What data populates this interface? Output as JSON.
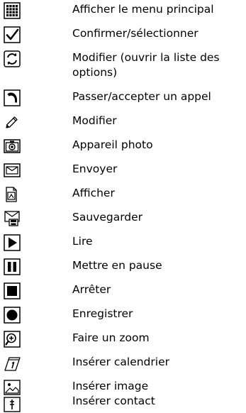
{
  "items": [
    {
      "icon": "main-menu-grid-icon",
      "label": "Afficher le menu principal"
    },
    {
      "icon": "checkmark-icon",
      "label": "Confirmer/sélectionner"
    },
    {
      "icon": "options-cycle-icon",
      "label": "Modifier (ouvrir la liste des options)"
    },
    {
      "icon": "phone-handset-icon",
      "label": "Passer/accepter un appel"
    },
    {
      "icon": "pencil-icon",
      "label": "Modifier"
    },
    {
      "icon": "camera-icon",
      "label": "Appareil photo"
    },
    {
      "icon": "envelope-icon",
      "label": "Envoyer"
    },
    {
      "icon": "display-icon",
      "label": "Afficher"
    },
    {
      "icon": "save-icon",
      "label": "Sauvegarder"
    },
    {
      "icon": "play-icon",
      "label": "Lire"
    },
    {
      "icon": "pause-icon",
      "label": "Mettre en pause"
    },
    {
      "icon": "stop-icon",
      "label": "Arrêter"
    },
    {
      "icon": "record-icon",
      "label": "Enregistrer"
    },
    {
      "icon": "zoom-icon",
      "label": "Faire un zoom"
    },
    {
      "icon": "calendar-icon",
      "label": "Insérer calendrier"
    },
    {
      "icon": "image-icon",
      "label": "Insérer image"
    },
    {
      "icon": "contact-icon",
      "label": "Insérer contact"
    }
  ]
}
